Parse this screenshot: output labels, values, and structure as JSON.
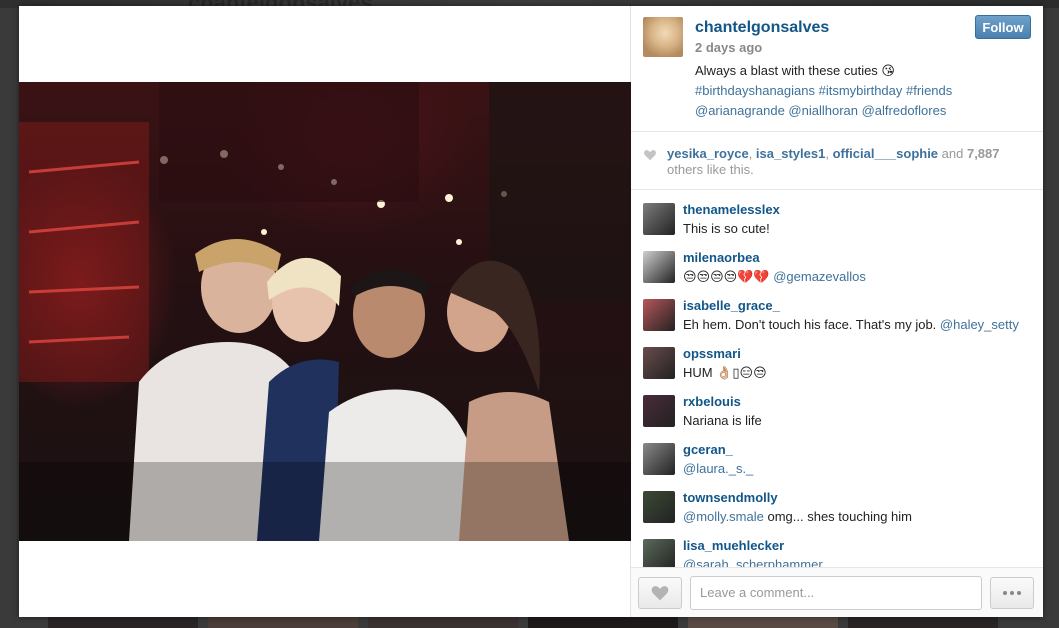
{
  "background": {
    "behind_title": "chantelgonsalves"
  },
  "post": {
    "username": "chantelgonsalves",
    "time_ago": "2 days ago",
    "caption_text": "Always a blast with these cuties 😘",
    "hashtags": "#birthdayshanagians #itsmybirthday #friends",
    "mentions": "@arianagrande @niallhoran @alfredoflores",
    "follow_label": "Follow",
    "photo_icon": "photo-icon"
  },
  "likes": {
    "user1": "yesika_royce",
    "sep1": ", ",
    "user2": "isa_styles1",
    "sep2": ", ",
    "user3": "official___sophie",
    "and": " and ",
    "count": "7,887",
    "others": "others like this."
  },
  "comments": [
    {
      "user": "thenamelesslex",
      "text": "This is so cute!",
      "mention": "",
      "color": "#7d7d7d"
    },
    {
      "user": "milenaorbea",
      "text": "😒😒😒😒💔💔 ",
      "mention": "@gemazevallos",
      "color": "#cfcfcf"
    },
    {
      "user": "isabelle_grace_",
      "text": "Eh hem. Don't touch his face. That's my job. ",
      "mention": "@haley_setty",
      "color": "#b8565a"
    },
    {
      "user": "opssmari",
      "text": "HUM 👌🏼▯😑😒",
      "mention": "",
      "color": "#6a4c4c"
    },
    {
      "user": "rxbelouis",
      "text": "Nariana is life",
      "mention": "",
      "color": "#4a2a3a"
    },
    {
      "user": "gceran_",
      "text": "",
      "mention": "@laura._s._",
      "color": "#8a8a8a"
    },
    {
      "user": "townsendmolly",
      "text": " omg... shes touching him",
      "mention": "@molly.smale",
      "color": "#3c4a36"
    },
    {
      "user": "lisa_muehlecker",
      "text": "",
      "mention": "@sarah_scherphammer",
      "color": "#5a6a5a"
    }
  ],
  "footer": {
    "placeholder": "Leave a comment..."
  }
}
